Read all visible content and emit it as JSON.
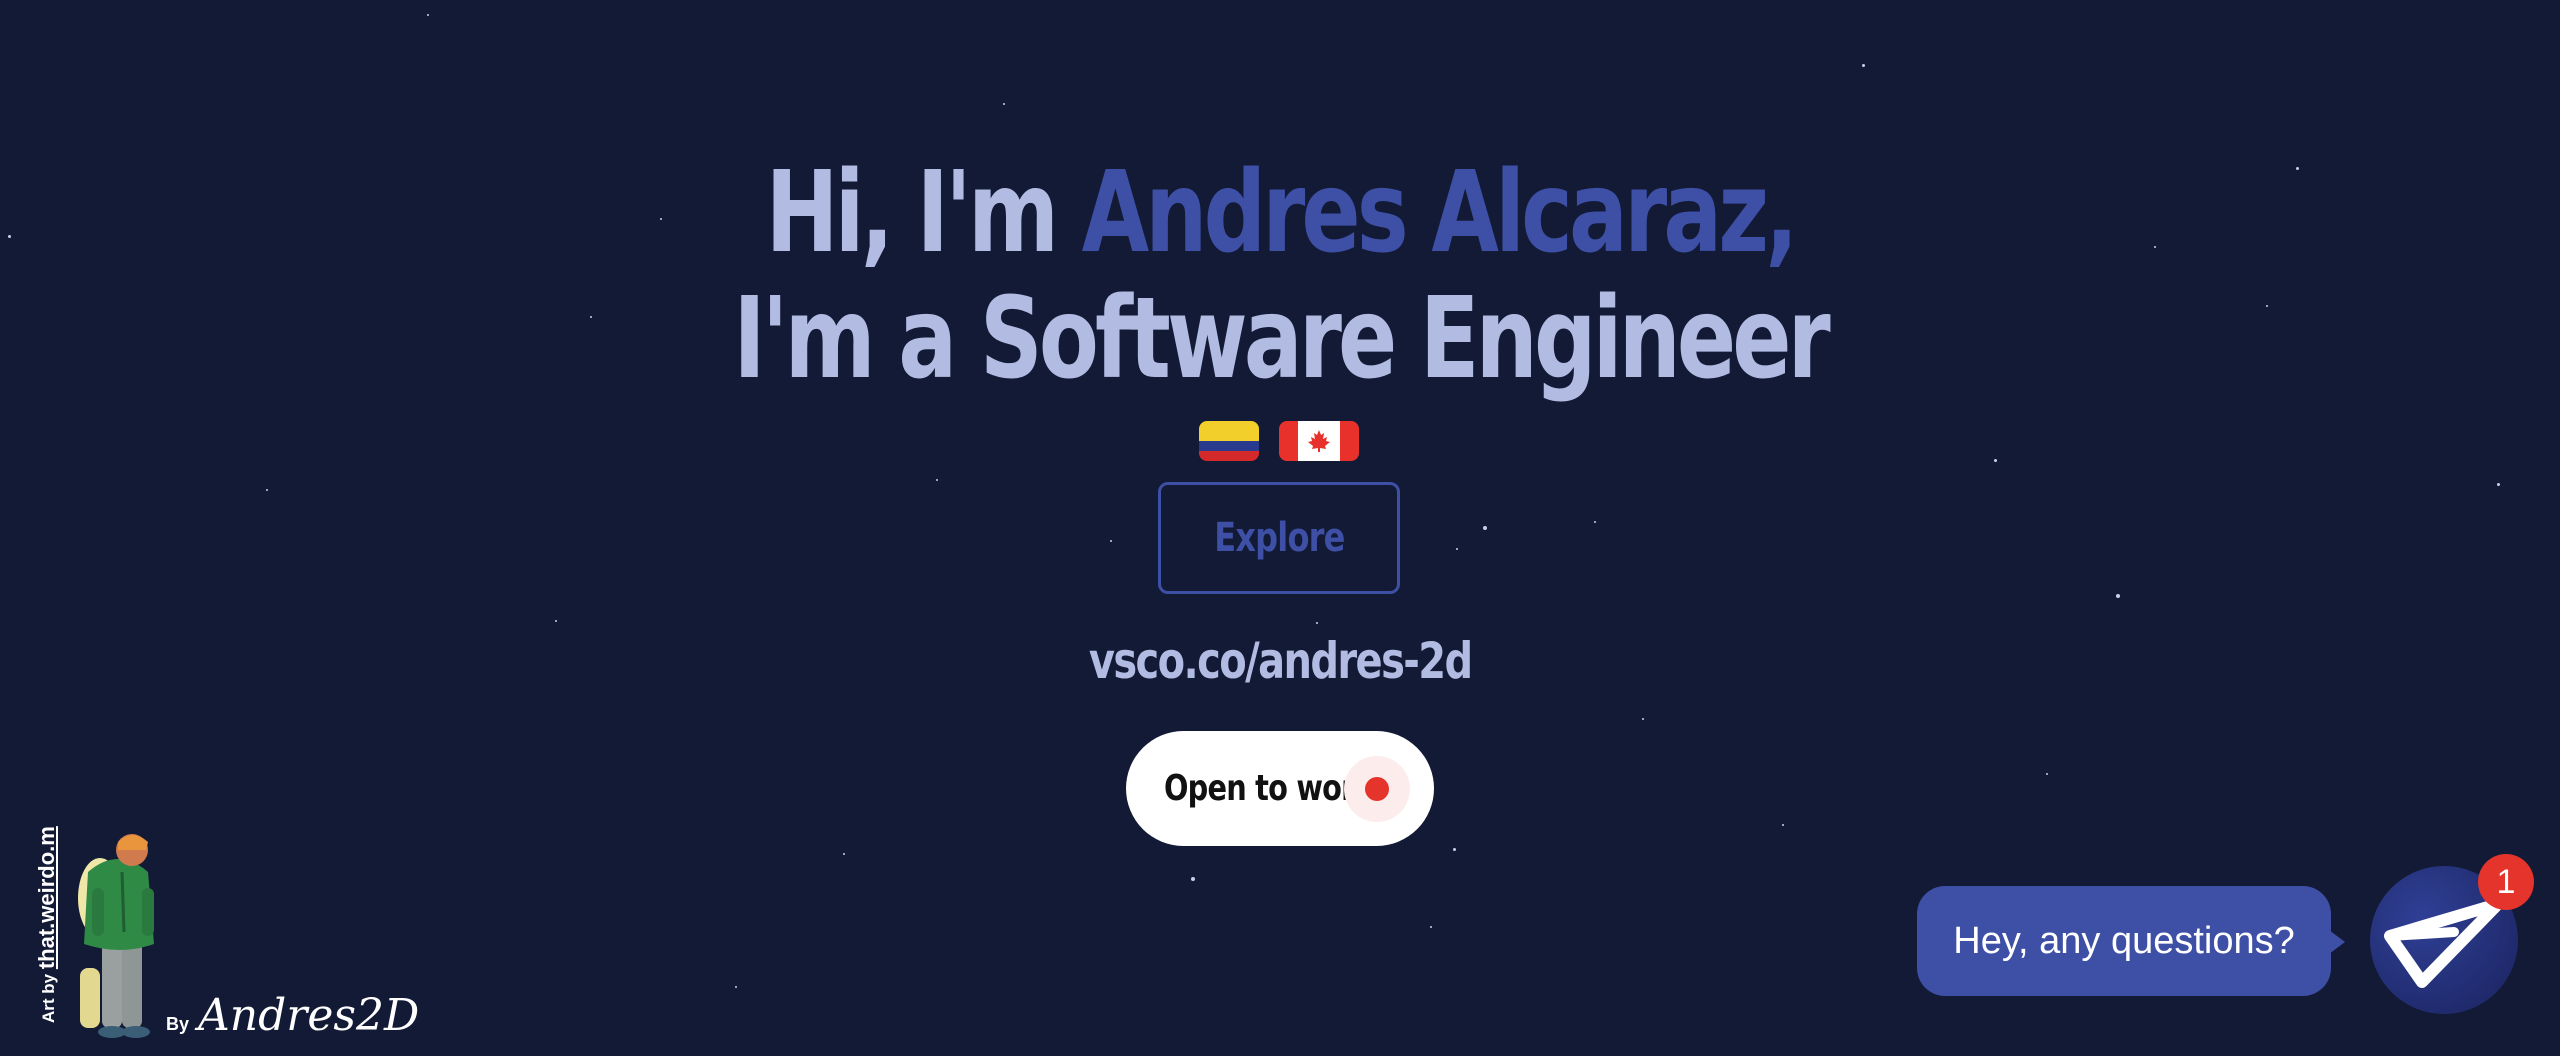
{
  "hero": {
    "greeting_prefix": "Hi, I'm ",
    "name": "Andres Alcaraz,",
    "role_line": "I'm a Software Engineer"
  },
  "flags": [
    {
      "country": "Colombia",
      "icon": "colombia-flag-icon"
    },
    {
      "country": "Canada",
      "icon": "canada-flag-icon"
    }
  ],
  "explore_button": {
    "label": "Explore"
  },
  "vsco_link": {
    "text": "vsco.co/andres-2d"
  },
  "status": {
    "label": "Open to work",
    "indicator_color": "#e5342c"
  },
  "credit": {
    "art_by_prefix": "Art by ",
    "art_by_handle": "that.weirdo.m",
    "by_prefix": "By ",
    "signature": "Andres2D"
  },
  "chat": {
    "prompt": "Hey, any questions?",
    "badge_count": "1",
    "launcher_icon": "paper-plane-icon"
  },
  "colors": {
    "background": "#131a36",
    "accent": "#3e4fa6",
    "headline": "#b2bbe2",
    "status_red": "#e5342c"
  }
}
